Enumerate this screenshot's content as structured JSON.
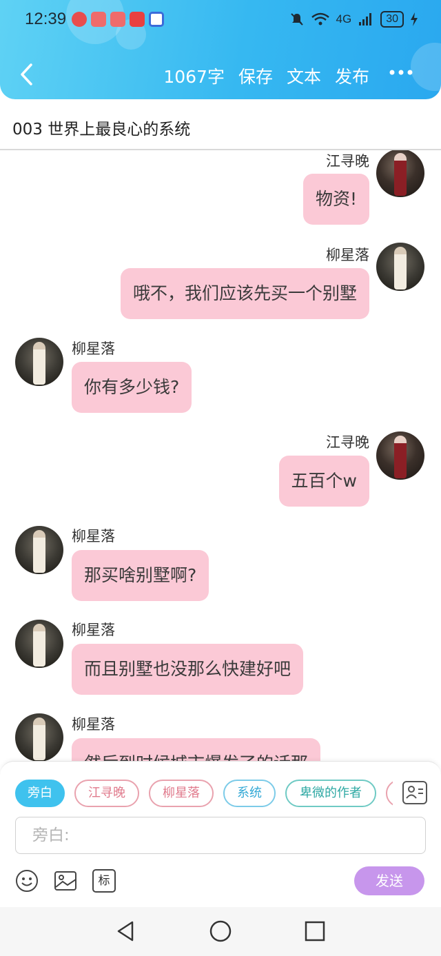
{
  "status_bar": {
    "time": "12:39",
    "network": "4G",
    "battery": "30",
    "app_icon_colors": [
      "#e84d4d",
      "#ef6b6b",
      "#ef6b6b",
      "#e84040",
      "#3b6bd9"
    ]
  },
  "header": {
    "word_count": "1067字",
    "actions": [
      "保存",
      "文本",
      "发布"
    ],
    "more_icon": "more-horizontal-icon",
    "back_icon": "chevron-left-icon"
  },
  "chapter_title": "003 世界上最良心的系统",
  "messages": [
    {
      "side": "right",
      "name": "江寻晚",
      "text": "物资!",
      "avatar": "red-dress"
    },
    {
      "side": "right",
      "name": "柳星落",
      "text": "哦不，我们应该先买一个别墅",
      "avatar": "white-dress"
    },
    {
      "side": "left",
      "name": "柳星落",
      "text": "你有多少钱?",
      "avatar": "white-dress"
    },
    {
      "side": "right",
      "name": "江寻晚",
      "text": "五百个w",
      "avatar": "red-dress"
    },
    {
      "side": "left",
      "name": "柳星落",
      "text": "那买啥别墅啊?",
      "avatar": "white-dress"
    },
    {
      "side": "left",
      "name": "柳星落",
      "text": "而且别墅也没那么快建好吧",
      "avatar": "white-dress"
    },
    {
      "side": "left",
      "name": "柳星落",
      "text": "然后到时候城市爆发了的话那",
      "avatar": "white-dress"
    }
  ],
  "roles": [
    "旁白",
    "江寻晚",
    "柳星落",
    "系统",
    "卑微的作者"
  ],
  "input": {
    "placeholder": "旁白:"
  },
  "tools": [
    "emoji-icon",
    "image-icon",
    "tag-icon"
  ],
  "tag_label": "标",
  "send_label": "发送",
  "colors": {
    "header_start": "#5fd2f4",
    "header_end": "#2aa8ef",
    "bubble": "#fbc9d6",
    "send": "#c796ec",
    "active_chip": "#3fc2ee"
  }
}
